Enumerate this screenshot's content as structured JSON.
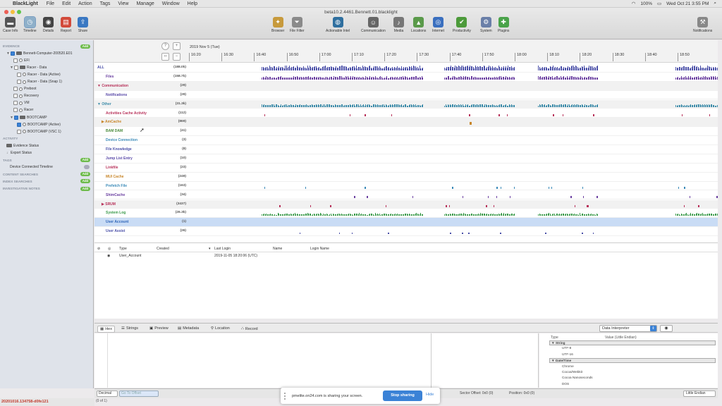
{
  "menubar": {
    "app": "BlackLight",
    "items": [
      "File",
      "Edit",
      "Action",
      "Tags",
      "View",
      "Manage",
      "Window",
      "Help"
    ],
    "clock": "Wed Oct 21  3:55 PM",
    "battery": "100%"
  },
  "window": {
    "title": "beta10.2.4461.Bennett.01.blacklight"
  },
  "toolbar": {
    "left": [
      {
        "label": "Case Info",
        "icon": "briefcase-icon",
        "color": "#555555"
      },
      {
        "label": "Timeline",
        "icon": "clock-icon",
        "color": "#8fb0c9"
      },
      {
        "label": "Details",
        "icon": "eye-icon",
        "color": "#444444"
      },
      {
        "label": "Report",
        "icon": "report-icon",
        "color": "#d24a3a"
      },
      {
        "label": "Share",
        "icon": "share-icon",
        "color": "#3a78c2"
      }
    ],
    "center": [
      {
        "label": "Browser",
        "icon": "compass-icon",
        "color": "#c79a3c"
      },
      {
        "label": "File Filter",
        "icon": "funnel-icon",
        "color": "#8a8a8a"
      },
      {
        "label": "Actionable Intel",
        "icon": "globe-icon",
        "color": "#2f6f9f"
      },
      {
        "label": "Communication",
        "icon": "person-icon",
        "color": "#666666"
      },
      {
        "label": "Media",
        "icon": "media-icon",
        "color": "#777777"
      },
      {
        "label": "Locations",
        "icon": "map-icon",
        "color": "#5a9a4a"
      },
      {
        "label": "Internet",
        "icon": "internet-icon",
        "color": "#3a6fbf"
      },
      {
        "label": "Productivity",
        "icon": "productivity-icon",
        "color": "#4c9a3a"
      },
      {
        "label": "System",
        "icon": "system-icon",
        "color": "#6a7fa8"
      },
      {
        "label": "Plugins",
        "icon": "puzzle-icon",
        "color": "#4aa34a"
      }
    ],
    "right": {
      "label": "Notifications",
      "icon": "notifications-icon",
      "color": "#888888"
    }
  },
  "sidebar": {
    "rows": [
      {
        "type": "section",
        "label": "EVIDENCE",
        "indent": 0,
        "badge": "Add"
      },
      {
        "type": "item",
        "label": "Bennett-Computer-200520.E01",
        "indent": 1,
        "arrow": "▼",
        "check": true,
        "icon": "dev"
      },
      {
        "type": "item",
        "label": "EFI",
        "indent": 3,
        "check": false,
        "icon": "cyl"
      },
      {
        "type": "item",
        "label": "Racer - Data",
        "indent": 2,
        "arrow": "▼",
        "check": false,
        "icon": "dev"
      },
      {
        "type": "item",
        "label": "Racer - Data (Active)",
        "indent": 4,
        "check": false,
        "icon": "cyl"
      },
      {
        "type": "item",
        "label": "Racer - Data (Snap 1)",
        "indent": 4,
        "check": false,
        "icon": "cyl"
      },
      {
        "type": "item",
        "label": "Preboot",
        "indent": 3,
        "check": false,
        "icon": "cyl"
      },
      {
        "type": "item",
        "label": "Recovery",
        "indent": 3,
        "check": false,
        "icon": "cyl"
      },
      {
        "type": "item",
        "label": "VM",
        "indent": 3,
        "check": false,
        "icon": "cyl"
      },
      {
        "type": "item",
        "label": "Racer",
        "indent": 3,
        "check": false,
        "icon": "cyl"
      },
      {
        "type": "item",
        "label": "BOOTCAMP",
        "indent": 2,
        "arrow": "▼",
        "check": true,
        "icon": "dev"
      },
      {
        "type": "item",
        "label": "BOOTCAMP (Active)",
        "indent": 4,
        "check": true,
        "icon": "cyl"
      },
      {
        "type": "item",
        "label": "BOOTCAMP (VSC 1)",
        "indent": 4,
        "check": false,
        "icon": "cyl"
      },
      {
        "type": "section",
        "label": "ACTIVITY",
        "indent": 0
      },
      {
        "type": "item",
        "label": "Evidence Status",
        "indent": 1,
        "icon": "dev"
      },
      {
        "type": "item",
        "label": "Export Status",
        "indent": 1,
        "arrow": "↓"
      },
      {
        "type": "section",
        "label": "TAGS",
        "indent": 0,
        "badge": "Add"
      },
      {
        "type": "item",
        "label": "Device Connected Timeline",
        "indent": 2,
        "pill": true
      },
      {
        "type": "section",
        "label": "CONTENT SEARCHES",
        "indent": 0,
        "badge": "Add"
      },
      {
        "type": "section",
        "label": "INDEX SEARCHES",
        "indent": 0,
        "badge": "Add"
      },
      {
        "type": "section",
        "label": "INVESTIGATIVE NOTES",
        "indent": 0,
        "badge": "Add"
      }
    ]
  },
  "timeline": {
    "date": "2019 Nov 5 (Tue)",
    "ticks": [
      "16:20",
      "16:30",
      "16:40",
      "16:50",
      "17:00",
      "17:10",
      "17:20",
      "17:30",
      "17:40",
      "17:50",
      "18:00",
      "18:10",
      "18:20",
      "18:30",
      "18:40",
      "18:50"
    ],
    "rows": [
      {
        "label": "ALL",
        "count": "(188.0k)",
        "color": "#4a4fa8",
        "indent": 0,
        "group": false,
        "pattern": "dense",
        "height": 7
      },
      {
        "label": "Files",
        "count": "(158.7k)",
        "color": "#6a3fa0",
        "indent": 4,
        "group": false,
        "pattern": "dense",
        "height": 5
      },
      {
        "label": "▼ Communication",
        "count": "(29)",
        "color": "#b8325a",
        "indent": 0,
        "group": true,
        "pattern": "none"
      },
      {
        "label": "Notifications",
        "count": "(29)",
        "color": "#5a4aa8",
        "indent": 4,
        "group": false,
        "pattern": "none"
      },
      {
        "label": "▼ Other",
        "count": "(31.3k)",
        "color": "#3a8aa8",
        "indent": 0,
        "group": true,
        "pattern": "dense",
        "height": 4
      },
      {
        "label": "Activities Cache Activity",
        "count": "(112)",
        "color": "#b8325a",
        "indent": 4,
        "group": false,
        "pattern": "sparse"
      },
      {
        "label": "▶ AmCache",
        "count": "(869)",
        "color": "#c8862a",
        "indent": 2,
        "group": true,
        "pattern": "single"
      },
      {
        "label": "BAM DAM",
        "count": "(41)",
        "color": "#4a8a3a",
        "indent": 4,
        "group": false,
        "pattern": "none"
      },
      {
        "label": "Device Connection",
        "count": "(3)",
        "color": "#3a8ab8",
        "indent": 4,
        "group": false,
        "pattern": "none"
      },
      {
        "label": "File Knowledge",
        "count": "(8)",
        "color": "#4a4fa8",
        "indent": 4,
        "group": false,
        "pattern": "none"
      },
      {
        "label": "Jump List Entry",
        "count": "(10)",
        "color": "#5a4aa8",
        "indent": 4,
        "group": false,
        "pattern": "none"
      },
      {
        "label": "Linkfile",
        "count": "(23)",
        "color": "#b8325a",
        "indent": 4,
        "group": false,
        "pattern": "none"
      },
      {
        "label": "MUI Cache",
        "count": "(249)",
        "color": "#c8862a",
        "indent": 4,
        "group": false,
        "pattern": "none"
      },
      {
        "label": "Prefetch File",
        "count": "(163)",
        "color": "#3a8ab8",
        "indent": 4,
        "group": false,
        "pattern": "sparse"
      },
      {
        "label": "ShimCache",
        "count": "(34)",
        "color": "#6a3fa0",
        "indent": 4,
        "group": false,
        "pattern": "sparse"
      },
      {
        "label": "▶ SRUM",
        "count": "(3437)",
        "color": "#b8325a",
        "indent": 2,
        "group": true,
        "pattern": "sparse"
      },
      {
        "label": "System Log",
        "count": "(26.3k)",
        "color": "#3a9a4a",
        "indent": 4,
        "group": false,
        "pattern": "dense",
        "height": 4
      },
      {
        "label": "User Account",
        "count": "(1)",
        "color": "#3a78c8",
        "indent": 4,
        "group": false,
        "pattern": "none",
        "selected": true
      },
      {
        "label": "User Assist",
        "count": "(26)",
        "color": "#4a4fa8",
        "indent": 4,
        "group": false,
        "pattern": "sparse"
      }
    ]
  },
  "table": {
    "columns": [
      "Type",
      "Created",
      "Last Login",
      "Name",
      "Login Name"
    ],
    "rows": [
      {
        "type": "User_Account",
        "created": "",
        "last_login": "2019-11-05 18:20:06 (UTC)",
        "name": "",
        "login_name": ""
      }
    ]
  },
  "bottom_tabs": [
    "Hex",
    "Strings",
    "Preview",
    "Metadata",
    "Location",
    "Record"
  ],
  "interpreter": {
    "selected": "Data Interpreter",
    "col_type": "Type",
    "col_value": "Value (Little Endian)",
    "rows": [
      {
        "label": "String",
        "group": true
      },
      {
        "label": "UTF-8",
        "group": false
      },
      {
        "label": "UTF-16",
        "group": false
      },
      {
        "label": "Date/Time",
        "group": true
      },
      {
        "label": "Chrome",
        "group": false
      },
      {
        "label": "Cocoa/Webkit",
        "group": false
      },
      {
        "label": "Cocoa Nanoseconds",
        "group": false
      },
      {
        "label": "DOS",
        "group": false
      }
    ]
  },
  "status": {
    "mode": "Decimal",
    "go_to_offset_placeholder": "Go To Offset",
    "sector_offset": "Sector Offset: 0x0 (0)",
    "position": "Position: 0x0 (0)",
    "endian": "Little Endian"
  },
  "share_banner": {
    "message": "pmelite.on24.com is sharing your screen.",
    "stop": "Stop sharing",
    "hide": "Hide"
  },
  "footer": {
    "build": "20201016.134758-d0fe121",
    "count": "(0 of 1)"
  }
}
